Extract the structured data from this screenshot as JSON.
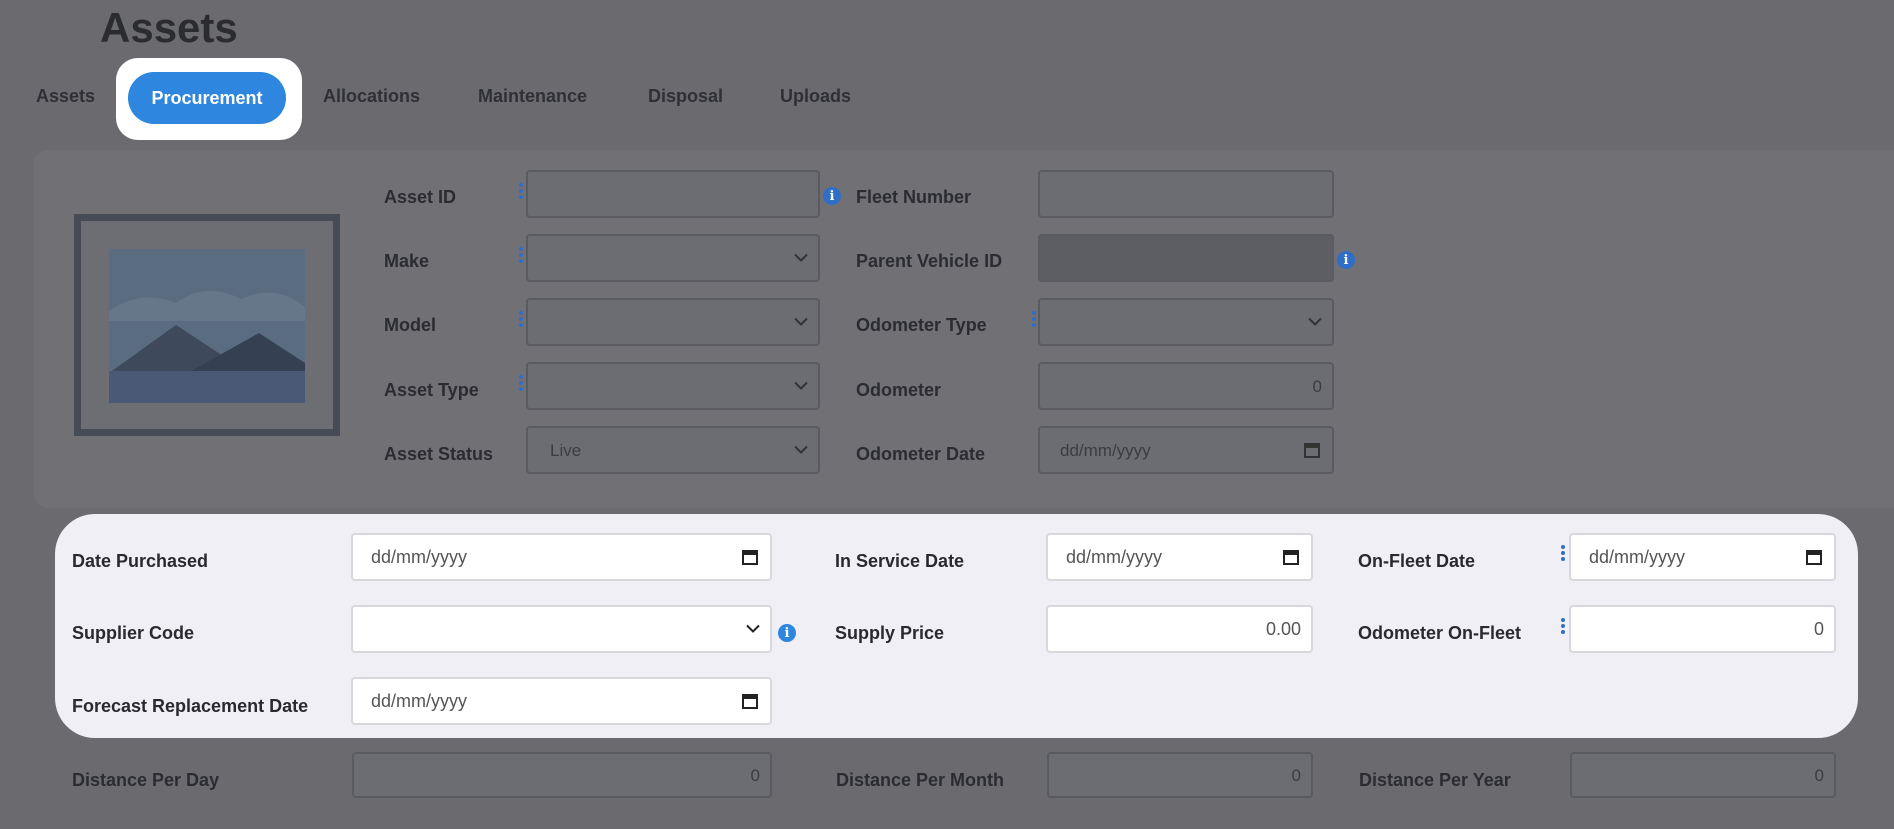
{
  "page": {
    "title": "Assets"
  },
  "tabs": [
    "Assets",
    "Procurement",
    "Allocations",
    "Maintenance",
    "Disposal",
    "Uploads"
  ],
  "active_tab": "Procurement",
  "asset_panel": {
    "asset_id_label": "Asset ID",
    "make_label": "Make",
    "model_label": "Model",
    "asset_type_label": "Asset Type",
    "asset_status_label": "Asset Status",
    "asset_status_value": "Live",
    "fleet_number_label": "Fleet Number",
    "parent_vehicle_id_label": "Parent Vehicle ID",
    "odometer_type_label": "Odometer Type",
    "odometer_label": "Odometer",
    "odometer_value": "0",
    "odometer_date_label": "Odometer Date",
    "odometer_date_placeholder": "dd/mm/yyyy"
  },
  "procurement": {
    "date_purchased_label": "Date Purchased",
    "date_purchased_placeholder": "dd/mm/yyyy",
    "supplier_code_label": "Supplier Code",
    "forecast_replacement_label": "Forecast Replacement Date",
    "forecast_replacement_placeholder": "dd/mm/yyyy",
    "in_service_label": "In Service Date",
    "in_service_placeholder": "dd/mm/yyyy",
    "supply_price_label": "Supply Price",
    "supply_price_value": "0.00",
    "on_fleet_label": "On-Fleet Date",
    "on_fleet_placeholder": "dd/mm/yyyy",
    "odometer_on_fleet_label": "Odometer On-Fleet",
    "odometer_on_fleet_value": "0"
  },
  "distance": {
    "per_day_label": "Distance Per Day",
    "per_day_value": "0",
    "per_month_label": "Distance Per Month",
    "per_month_value": "0",
    "per_year_label": "Distance Per Year",
    "per_year_value": "0"
  },
  "icons": {
    "info": "info-icon",
    "more": "more-vertical-icon",
    "calendar": "calendar-icon",
    "chevron": "chevron-down-icon",
    "placeholder_image": "image-placeholder-icon"
  },
  "colors": {
    "accent": "#2e86de",
    "info": "#2f6ec6"
  }
}
